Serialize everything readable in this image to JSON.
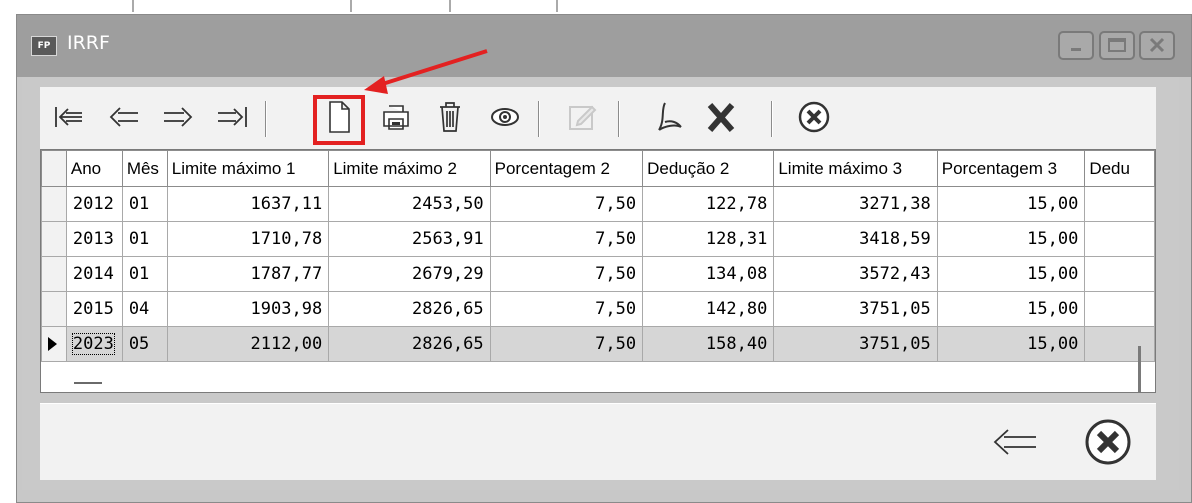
{
  "window": {
    "title": "IRRF",
    "badge": "FP"
  },
  "toolbar": {
    "buttons": [
      {
        "icon": "first-record-icon"
      },
      {
        "icon": "previous-record-icon"
      },
      {
        "icon": "next-record-icon"
      },
      {
        "icon": "last-record-icon"
      },
      {
        "icon": "new-document-icon",
        "highlighted": true
      },
      {
        "icon": "print-icon"
      },
      {
        "icon": "trash-icon"
      },
      {
        "icon": "view-eye-icon"
      },
      {
        "icon": "edit-icon",
        "disabled": true
      },
      {
        "icon": "pdf-export-icon"
      },
      {
        "icon": "excel-export-icon",
        "text": "X"
      },
      {
        "icon": "close-circle-icon"
      }
    ]
  },
  "grid": {
    "columns": [
      "Ano",
      "Mês",
      "Limite máximo 1",
      "Limite máximo 2",
      "Porcentagem 2",
      "Dedução 2",
      "Limite máximo 3",
      "Porcentagem 3",
      "Dedu"
    ],
    "rows": [
      [
        "2012",
        "01",
        "1637,11",
        "2453,50",
        "7,50",
        "122,78",
        "3271,38",
        "15,00",
        ""
      ],
      [
        "2013",
        "01",
        "1710,78",
        "2563,91",
        "7,50",
        "128,31",
        "3418,59",
        "15,00",
        ""
      ],
      [
        "2014",
        "01",
        "1787,77",
        "2679,29",
        "7,50",
        "134,08",
        "3572,43",
        "15,00",
        ""
      ],
      [
        "2015",
        "04",
        "1903,98",
        "2826,65",
        "7,50",
        "142,80",
        "3751,05",
        "15,00",
        ""
      ],
      [
        "2023",
        "05",
        "2112,00",
        "2826,65",
        "7,50",
        "158,40",
        "3751,05",
        "15,00",
        ""
      ]
    ],
    "selected_row": 4
  },
  "footer": {
    "buttons": [
      {
        "icon": "back-arrow-icon"
      },
      {
        "icon": "close-circle-icon"
      }
    ]
  },
  "colors": {
    "annotation": "#e32121",
    "titlebar": "#9e9e9e",
    "selected_row": "#d6d6d6"
  }
}
